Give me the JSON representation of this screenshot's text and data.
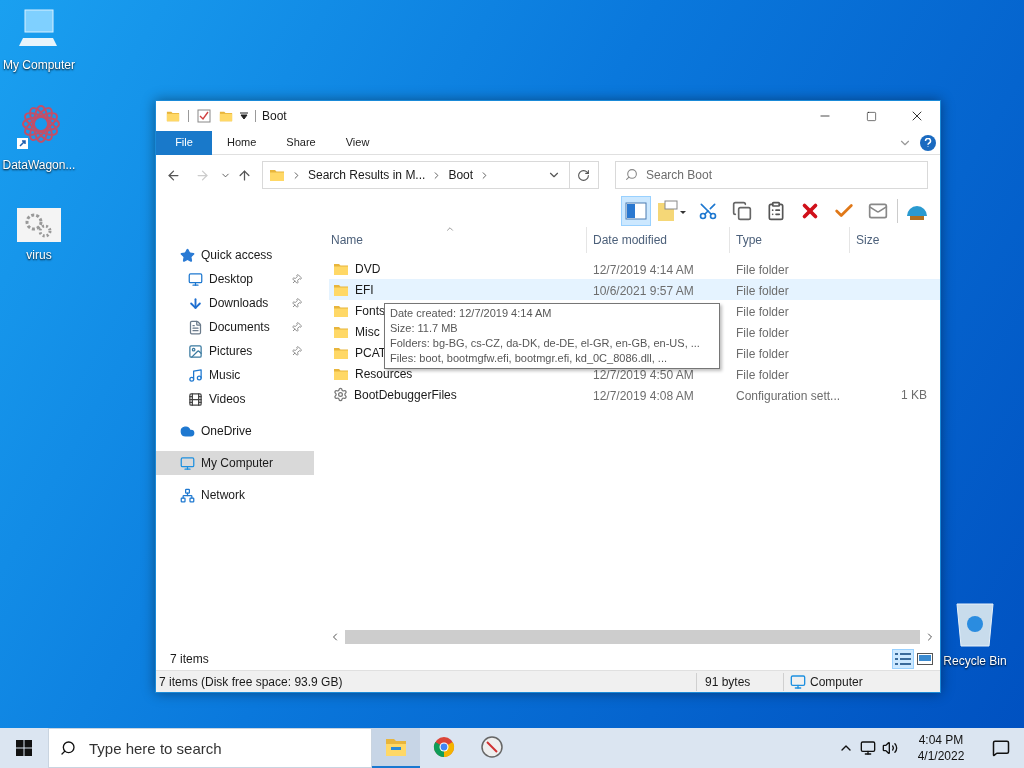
{
  "desktop_icons": [
    {
      "label": "My Computer",
      "kind": "computer"
    },
    {
      "label": "DataWagon...",
      "kind": "app"
    },
    {
      "label": "virus",
      "kind": "settings"
    },
    {
      "label": "Recycle Bin",
      "kind": "recycle"
    }
  ],
  "window": {
    "title": "Boot",
    "ribbon_tabs": [
      {
        "label": "File",
        "selected": true
      },
      {
        "label": "Home",
        "selected": false
      },
      {
        "label": "Share",
        "selected": false
      },
      {
        "label": "View",
        "selected": false
      }
    ],
    "address": {
      "crumbs": [
        "Search Results in M...",
        "Boot"
      ]
    },
    "search": {
      "placeholder": "Search Boot"
    },
    "toolbar": [
      {
        "kind": "pane",
        "selected": true
      },
      {
        "kind": "properties",
        "selected": false
      },
      {
        "kind": "cut",
        "selected": false
      },
      {
        "kind": "copy",
        "selected": false
      },
      {
        "kind": "paste",
        "selected": false
      },
      {
        "kind": "delete",
        "selected": false
      },
      {
        "kind": "check",
        "selected": false
      },
      {
        "kind": "rename",
        "selected": false
      },
      {
        "kind": "shell",
        "selected": false
      }
    ],
    "nav_pane": [
      {
        "label": "Quick access",
        "kind": "star",
        "pinned": false,
        "selected": false,
        "children": [
          {
            "label": "Desktop",
            "kind": "desktop",
            "pinned": true,
            "selected": false
          },
          {
            "label": "Downloads",
            "kind": "downloads",
            "pinned": true,
            "selected": false
          },
          {
            "label": "Documents",
            "kind": "documents",
            "pinned": true,
            "selected": false
          },
          {
            "label": "Pictures",
            "kind": "pictures",
            "pinned": true,
            "selected": false
          },
          {
            "label": "Music",
            "kind": "music",
            "pinned": false,
            "selected": false
          },
          {
            "label": "Videos",
            "kind": "videos",
            "pinned": false,
            "selected": false
          }
        ]
      },
      {
        "label": "OneDrive",
        "kind": "cloud",
        "pinned": false,
        "selected": false
      },
      {
        "label": "My Computer",
        "kind": "computer",
        "pinned": false,
        "selected": true
      },
      {
        "label": "Network",
        "kind": "network",
        "pinned": false,
        "selected": false
      }
    ],
    "columns": [
      "Name",
      "Date modified",
      "Type",
      "Size"
    ],
    "rows": [
      {
        "name": "DVD",
        "date": "12/7/2019 4:14 AM",
        "type": "File folder",
        "kind": "folder",
        "hovered": false
      },
      {
        "name": "EFI",
        "date": "10/6/2021 9:57 AM",
        "type": "File folder",
        "kind": "folder",
        "hovered": true
      },
      {
        "name": "Fonts",
        "type": "File folder",
        "kind": "folder",
        "hovered": false
      },
      {
        "name": "Misc",
        "type": "File folder",
        "kind": "folder",
        "hovered": false
      },
      {
        "name": "PCAT",
        "type": "File folder",
        "kind": "folder",
        "hovered": false
      },
      {
        "name": "Resources",
        "date": "12/7/2019 4:50 AM",
        "type": "File folder",
        "kind": "folder",
        "hovered": false
      },
      {
        "name": "BootDebuggerFiles",
        "date": "12/7/2019 4:08 AM",
        "type": "Configuration sett...",
        "size": "1 KB",
        "kind": "config",
        "hovered": false
      }
    ],
    "tooltip": [
      "Date created: 12/7/2019 4:14 AM",
      "Size: 11.7 MB",
      "Folders: bg-BG, cs-CZ, da-DK, de-DE, el-GR, en-GB, en-US, ...",
      "Files: boot, bootmgfw.efi, bootmgr.efi, kd_0C_8086.dll, ..."
    ],
    "item_count": "7 items",
    "view_buttons": [
      {
        "kind": "details",
        "selected": true
      },
      {
        "kind": "thumbnails",
        "selected": false
      }
    ],
    "status_bar": {
      "summary": "7 items (Disk free space: 93.9 GB)",
      "size": "91 bytes",
      "location": "Computer"
    }
  },
  "taskbar": {
    "search_placeholder": "Type here to search",
    "apps": [
      {
        "kind": "explorer",
        "selected": true
      },
      {
        "kind": "chrome",
        "selected": false
      },
      {
        "kind": "compass",
        "selected": false
      }
    ],
    "time": "4:04 PM",
    "date": "4/1/2022"
  }
}
